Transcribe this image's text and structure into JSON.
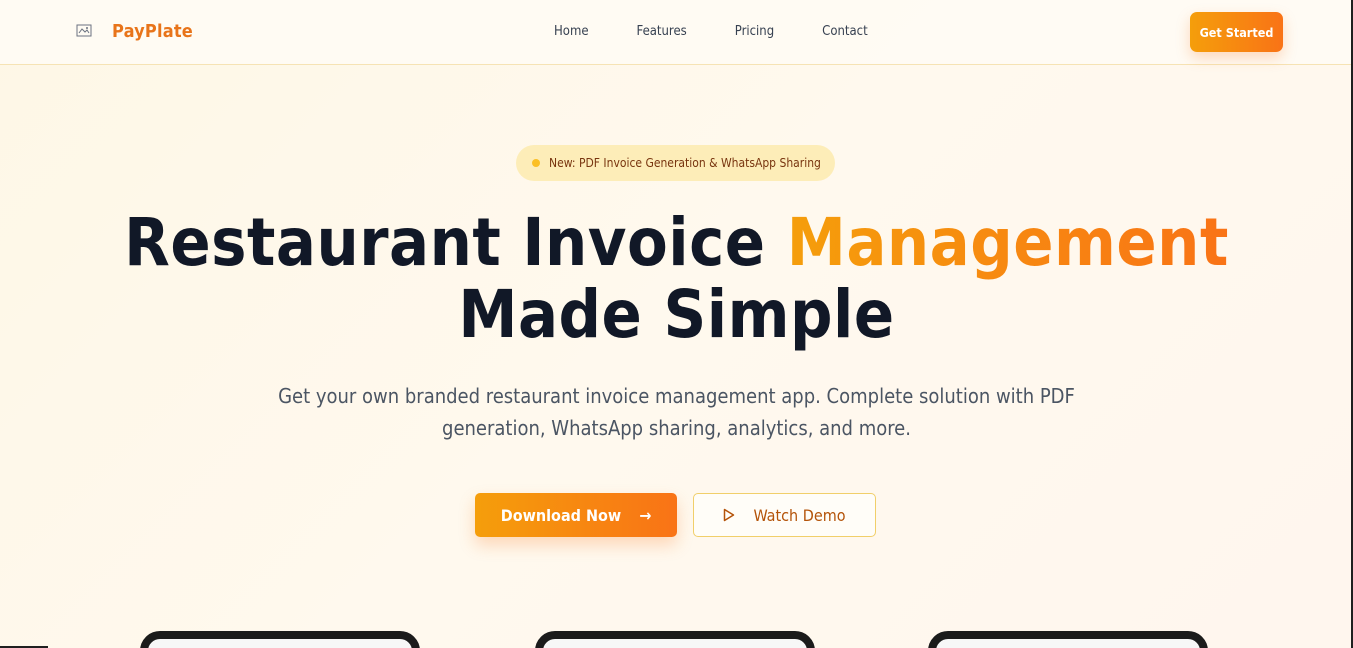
{
  "nav": {
    "brand_name": "PayPlate",
    "logo_icon": "broken-image-icon",
    "links": [
      "Home",
      "Features",
      "Pricing",
      "Contact"
    ],
    "cta": "Get Started"
  },
  "hero": {
    "badge": "New: PDF Invoice Generation & WhatsApp Sharing",
    "title_part1": "Restaurant Invoice ",
    "title_accent": "Management",
    "title_line2": "Made Simple",
    "subtitle": "Get your own branded restaurant invoice management app. Complete solution with PDF generation, WhatsApp sharing, analytics, and more.",
    "primary_button": "Download Now",
    "secondary_button": "Watch Demo",
    "primary_icon": "arrow-right-icon",
    "secondary_icon": "play-icon"
  },
  "colors": {
    "brand": "#e8741a",
    "accent_start": "#f59e0b",
    "accent_end": "#f97316",
    "heading": "#111827"
  }
}
